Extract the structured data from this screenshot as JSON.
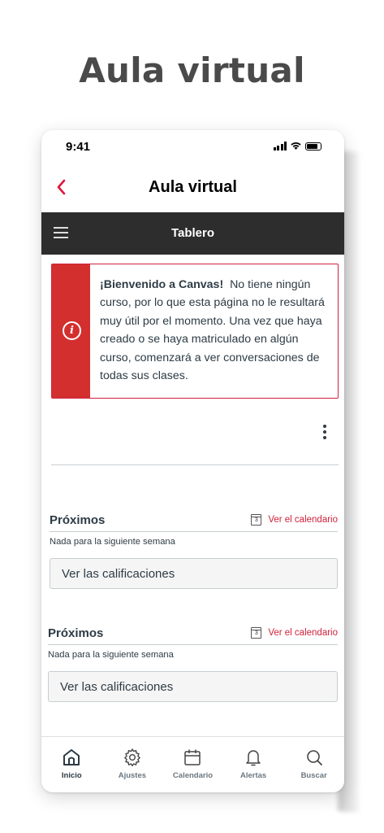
{
  "promo": {
    "title": "Aula virtual"
  },
  "status_bar": {
    "time": "9:41"
  },
  "nav": {
    "title": "Aula virtual",
    "back_icon": "chevron-left-icon",
    "accent": "#e0163c"
  },
  "dashboard_bar": {
    "title": "Tablero",
    "menu_icon": "hamburger-menu-icon",
    "background": "#2d2d2d"
  },
  "welcome_alert": {
    "heading": "¡Bienvenido a Canvas!",
    "message": "No tiene ningún curso, por lo que esta página no le resultará muy útil por el momento. Una vez que haya creado o se haya matriculado en algún curso, comenzará a ver conversaciones de todas sus clases.",
    "icon": "info-icon",
    "color": "#d32f2f"
  },
  "sections": [
    {
      "title": "Próximos",
      "calendar_link": "Ver el calendario",
      "empty_text": "Nada para la siguiente semana",
      "grades_button": "Ver las calificaciones"
    },
    {
      "title": "Próximos",
      "calendar_link": "Ver el calendario",
      "empty_text": "Nada para la siguiente semana",
      "grades_button": "Ver las calificaciones"
    }
  ],
  "tabs": [
    {
      "label": "Inicio",
      "icon": "home-icon",
      "active": true
    },
    {
      "label": "Ajustes",
      "icon": "gear-icon",
      "active": false
    },
    {
      "label": "Calendario",
      "icon": "calendar-icon",
      "active": false
    },
    {
      "label": "Alertas",
      "icon": "bell-icon",
      "active": false
    },
    {
      "label": "Buscar",
      "icon": "search-icon",
      "active": false
    }
  ]
}
